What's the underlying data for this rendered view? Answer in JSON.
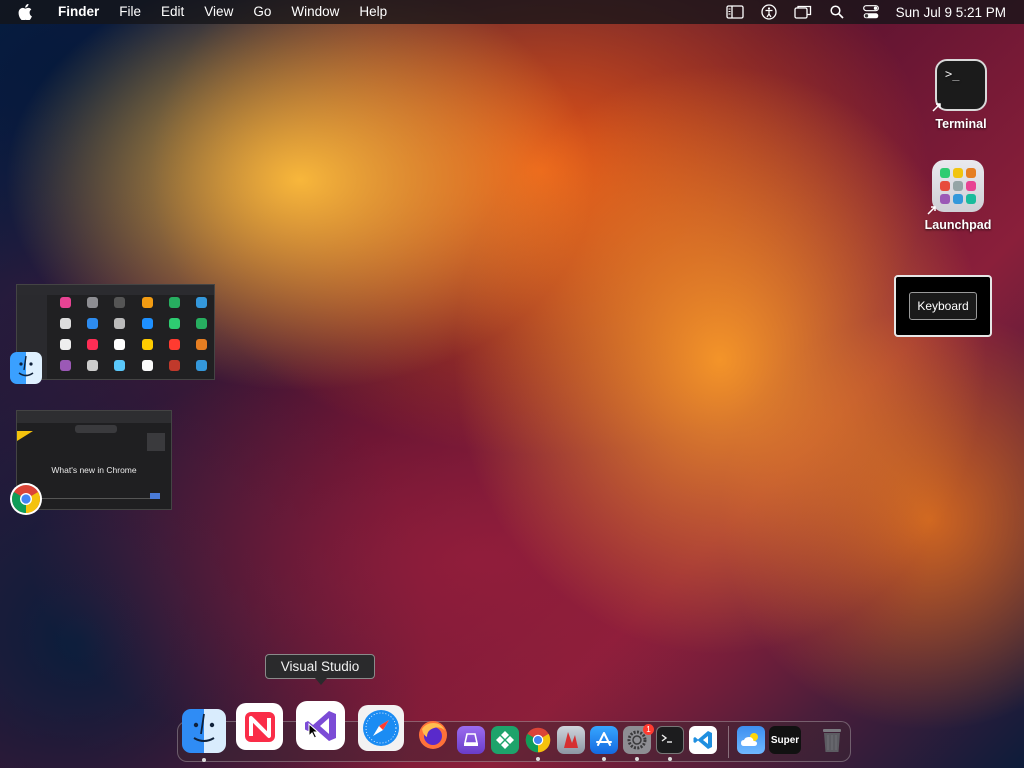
{
  "menubar": {
    "app_name": "Finder",
    "items": [
      "File",
      "Edit",
      "View",
      "Go",
      "Window",
      "Help"
    ],
    "clock": "Sun Jul 9  5:21 PM"
  },
  "desktop": {
    "icons": [
      {
        "label": "Terminal",
        "icon": "terminal-icon"
      },
      {
        "label": "Launchpad",
        "icon": "launchpad-icon"
      }
    ]
  },
  "keyboard_hud": {
    "label": "Keyboard"
  },
  "window_previews": [
    {
      "app": "Finder",
      "icon": "finder-icon"
    },
    {
      "app": "Chrome",
      "icon": "chrome-icon",
      "text": "What's new in Chrome"
    }
  ],
  "tooltip": {
    "text": "Visual Studio"
  },
  "dock": {
    "items": [
      {
        "name": "Finder",
        "icon": "finder-icon",
        "running": true
      },
      {
        "name": "News",
        "icon": "news-icon",
        "running": false
      },
      {
        "name": "Visual Studio",
        "icon": "visual-studio-icon",
        "running": false,
        "hovered": true
      },
      {
        "name": "Safari",
        "icon": "safari-icon",
        "running": false
      },
      {
        "name": "Firefox",
        "icon": "firefox-icon",
        "running": false
      },
      {
        "name": "Mail-like purple app",
        "icon": "purple-app-icon",
        "running": false
      },
      {
        "name": "Green diamond app",
        "icon": "green-app-icon",
        "running": false
      },
      {
        "name": "Chrome",
        "icon": "chrome-icon",
        "running": true
      },
      {
        "name": "Red app",
        "icon": "red-app-icon",
        "running": false
      },
      {
        "name": "App Store",
        "icon": "app-store-icon",
        "running": true
      },
      {
        "name": "System Settings",
        "icon": "settings-icon",
        "running": true,
        "badge": "1"
      },
      {
        "name": "Terminal",
        "icon": "terminal-icon",
        "running": true
      },
      {
        "name": "Visual Studio Code",
        "icon": "vscode-icon",
        "running": false
      },
      {
        "name": "Weather",
        "icon": "weather-icon",
        "running": false
      },
      {
        "name": "Super",
        "icon": "super-icon",
        "running": false,
        "label": "Super"
      },
      {
        "name": "Trash",
        "icon": "trash-icon",
        "running": false
      }
    ]
  },
  "colors": {
    "accent_purple": "#7b4bd6",
    "badge_red": "#ff3b30",
    "menubar_bg": "#141418"
  }
}
